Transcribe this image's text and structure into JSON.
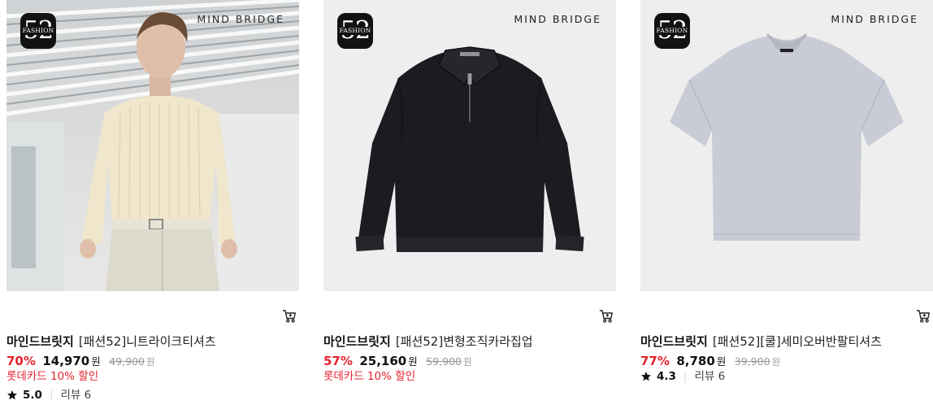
{
  "products": [
    {
      "logo_num": "52",
      "logo_word": "FASHION",
      "brand_mark": "MIND BRIDGE",
      "brand": "마인드브릿지",
      "name": "[패션52]니트라이크티셔츠",
      "discount": "70%",
      "sale_price": "14,970",
      "currency": "원",
      "original_price": "49,900",
      "original_currency": "원",
      "promo": "롯데카드 10% 할인",
      "rating": "5.0",
      "reviews": "리뷰 6"
    },
    {
      "logo_num": "52",
      "logo_word": "FASHION",
      "brand_mark": "MIND BRIDGE",
      "brand": "마인드브릿지",
      "name": "[패션52]변형조직카라집업",
      "discount": "57%",
      "sale_price": "25,160",
      "currency": "원",
      "original_price": "59,900",
      "original_currency": "원",
      "promo": "롯데카드 10% 할인"
    },
    {
      "logo_num": "52",
      "logo_word": "FASHION",
      "brand_mark": "MIND BRIDGE",
      "brand": "마인드브릿지",
      "name": "[패션52][쿨]세미오버반팔티셔츠",
      "discount": "77%",
      "sale_price": "8,780",
      "currency": "원",
      "original_price": "39,900",
      "original_currency": "원",
      "rating": "4.3",
      "reviews": "리뷰 6"
    }
  ],
  "colors": {
    "discount": "#e4232e",
    "promo": "#e4232e",
    "strike": "#999999"
  },
  "icons": {
    "cart": "cart-icon",
    "star": "star-icon"
  }
}
